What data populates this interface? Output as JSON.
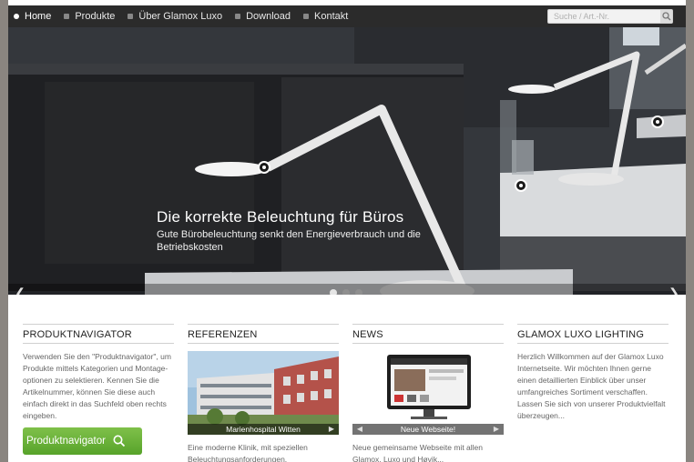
{
  "nav": {
    "items": [
      {
        "label": "Home"
      },
      {
        "label": "Produkte"
      },
      {
        "label": "Über Glamox Luxo"
      },
      {
        "label": "Download"
      },
      {
        "label": "Kontakt"
      }
    ],
    "search_placeholder": "Suche / Art.-Nr."
  },
  "hero": {
    "title": "Die korrekte Beleuchtung für Büros",
    "subtitle": "Gute Bürobeleuchtung senkt den Energieverbrauch und die Betriebskosten",
    "prev_arrow": "❮",
    "next_arrow": "❯"
  },
  "columns": {
    "produktnavigator": {
      "title": "PRODUKTNAVIGATOR",
      "text": "Verwenden Sie den \"Produktnavigator\", um Produkte mittels Kategorien und Montage-optionen zu selektieren. Kennen Sie die Artikelnummer, können Sie diese auch einfach direkt in das Suchfeld oben rechts eingeben.",
      "button": "Produktnavigator"
    },
    "referenzen": {
      "title": "REFERENZEN",
      "caption": "Marienhospital Witten",
      "text": "Eine moderne Klinik, mit speziellen Beleuchtungsanforderungen."
    },
    "news": {
      "title": "NEWS",
      "caption": "Neue Webseite!",
      "text": "Neue gemeinsame Webseite mit allen Glamox, Luxo und Høvik..."
    },
    "glamox": {
      "title": "GLAMOX LUXO LIGHTING",
      "text": "Herzlich Willkommen auf der Glamox Luxo Internetseite. Wir möchten Ihnen gerne einen detaillierten Einblick über unser umfangreiches Sortiment verschaffen. Lassen Sie sich von unserer Produktvielfalt überzeugen..."
    }
  },
  "colors": {
    "nav_bg": "#2b2b2b",
    "accent_green": "#6cb33f"
  }
}
